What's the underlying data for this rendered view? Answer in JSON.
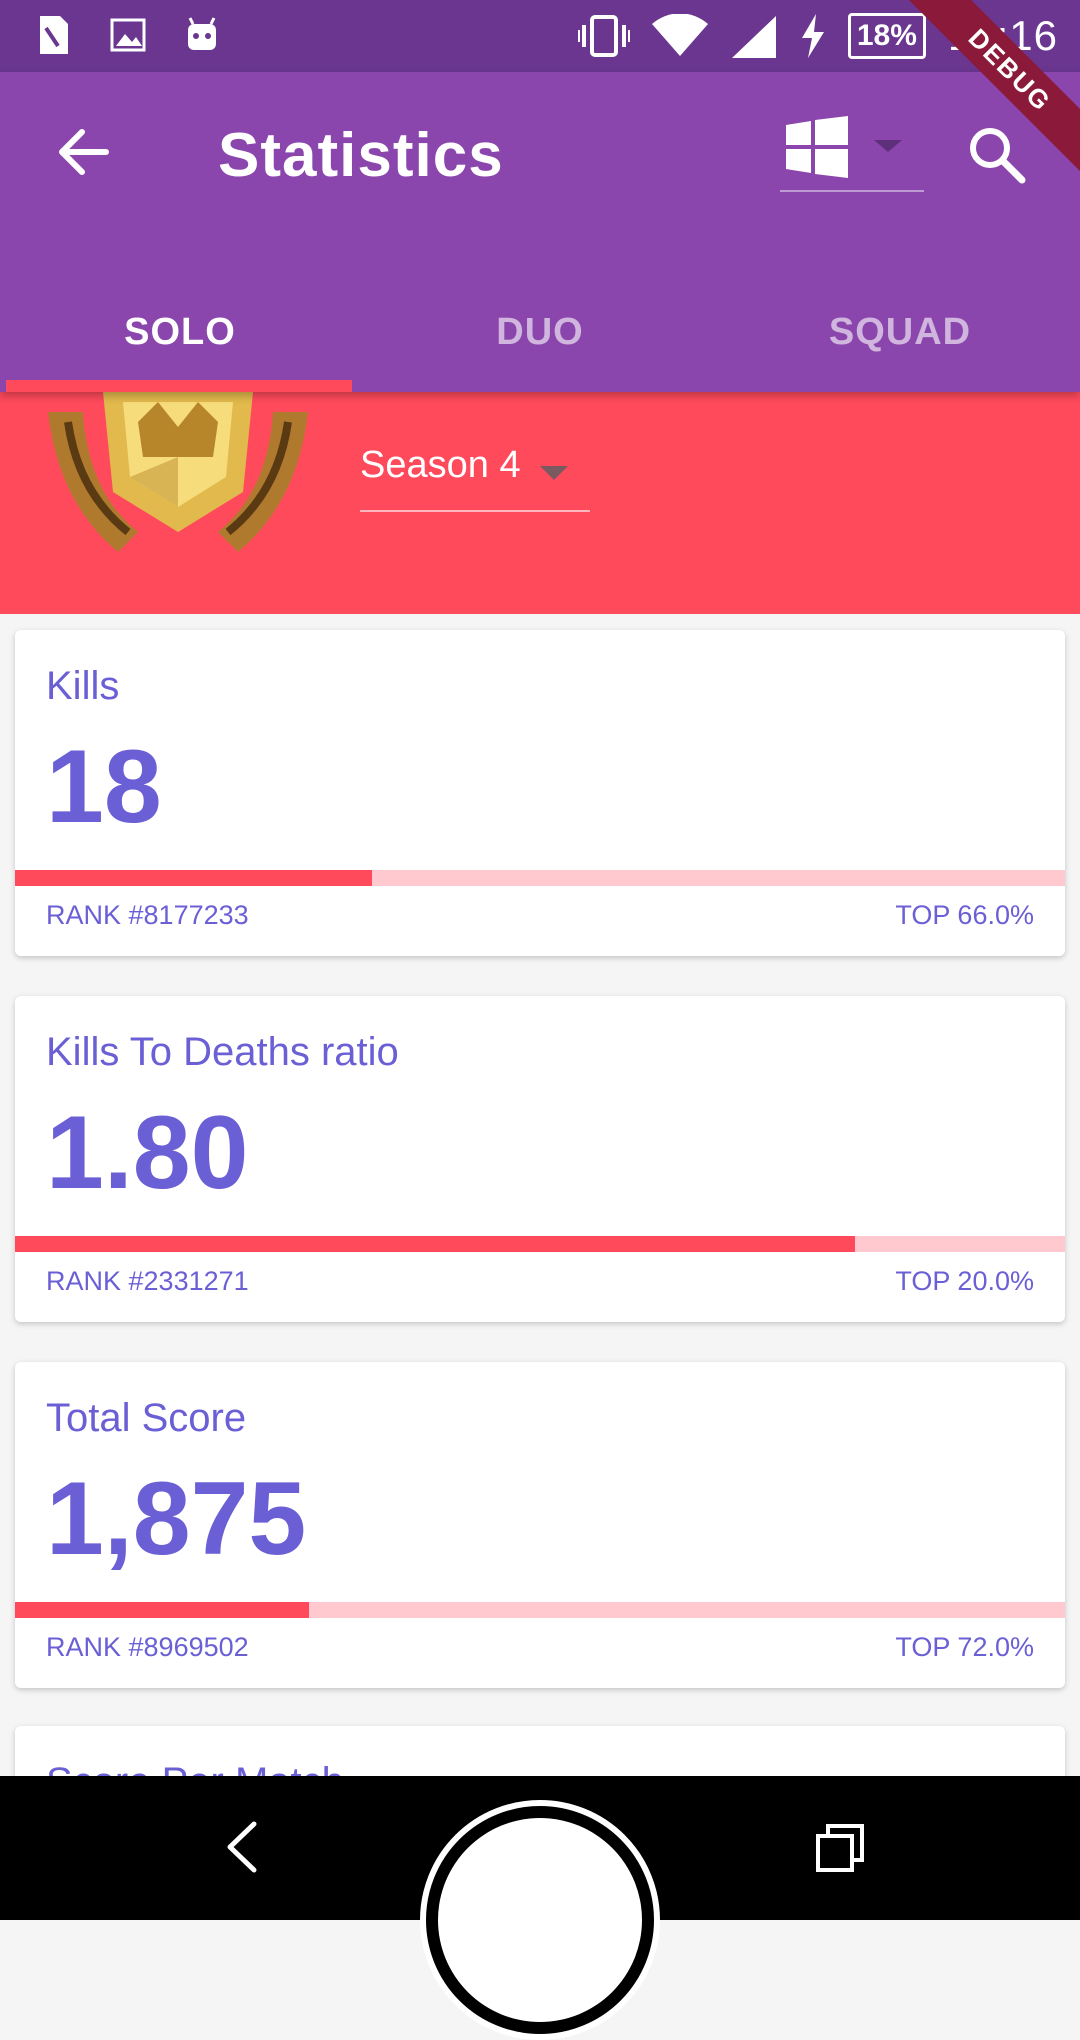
{
  "status_bar": {
    "battery": "18%",
    "time": "12:16"
  },
  "app_bar": {
    "title": "Statistics",
    "platform_icon": "windows-icon",
    "debug_label": "DEBUG"
  },
  "tabs": [
    {
      "label": "SOLO",
      "active": true
    },
    {
      "label": "DUO",
      "active": false
    },
    {
      "label": "SQUAD",
      "active": false
    }
  ],
  "header": {
    "season": "Season 4"
  },
  "stats": [
    {
      "label": "Kills",
      "value": "18",
      "rank": "RANK #8177233",
      "top": "TOP 66.0%",
      "progress": 0.34
    },
    {
      "label": "Kills To Deaths ratio",
      "value": "1.80",
      "rank": "RANK #2331271",
      "top": "TOP 20.0%",
      "progress": 0.8
    },
    {
      "label": "Total Score",
      "value": "1,875",
      "rank": "RANK #8969502",
      "top": "TOP 72.0%",
      "progress": 0.28
    },
    {
      "label": "Score Per Match"
    }
  ],
  "colors": {
    "status_bar": "#6a3690",
    "app_bar": "#8b46ad",
    "accent": "#ff4a5c",
    "stat_text": "#6b5fd6"
  }
}
